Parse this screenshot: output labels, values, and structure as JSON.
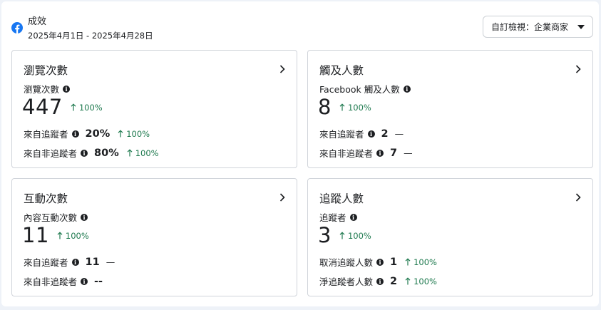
{
  "header": {
    "title": "成效",
    "date_range": "2025年4月1日 - 2025年4月28日",
    "view_select_label": "自訂檢視：企業商家"
  },
  "cards": [
    {
      "title": "瀏覽次數",
      "metric_label": "瀏覽次數",
      "value": "447",
      "trend": "100%",
      "rows": [
        {
          "label": "來自追蹤者",
          "value": "20%",
          "trend": "100%"
        },
        {
          "label": "來自非追蹤者",
          "value": "80%",
          "trend": "100%"
        }
      ]
    },
    {
      "title": "觸及人數",
      "metric_label": "Facebook 觸及人數",
      "value": "8",
      "trend": "100%",
      "rows": [
        {
          "label": "來自追蹤者",
          "value": "2",
          "dash": "—"
        },
        {
          "label": "來自非追蹤者",
          "value": "7",
          "dash": "—"
        }
      ]
    },
    {
      "title": "互動次數",
      "metric_label": "內容互動次數",
      "value": "11",
      "trend": "100%",
      "rows": [
        {
          "label": "來自追蹤者",
          "value": "11",
          "dash": "—"
        },
        {
          "label": "來自非追蹤者",
          "value": "--"
        }
      ]
    },
    {
      "title": "追蹤人數",
      "metric_label": "追蹤者",
      "value": "3",
      "trend": "100%",
      "rows": [
        {
          "label": "取消追蹤人數",
          "value": "1",
          "trend": "100%"
        },
        {
          "label": "淨追蹤者人數",
          "value": "2",
          "trend": "100%"
        }
      ]
    }
  ],
  "colors": {
    "brand": "#1877f2",
    "positive_trend": "#1f7a4f"
  },
  "icons": {
    "brand": "facebook-icon",
    "info": "info-icon",
    "trend": "arrow-up-icon",
    "navigate": "chevron-right-icon",
    "dropdown": "caret-down-icon"
  }
}
